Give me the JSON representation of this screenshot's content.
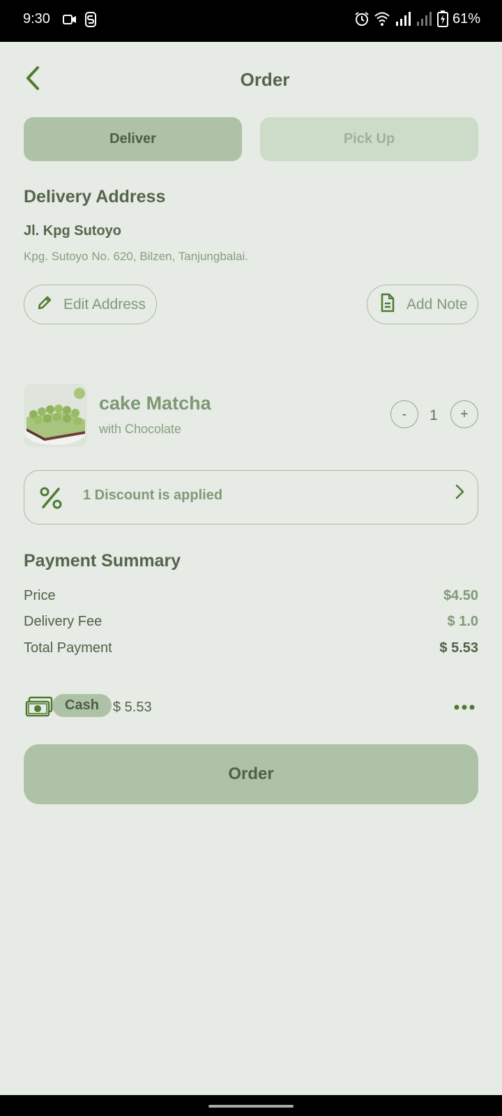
{
  "status_bar": {
    "time": "9:30",
    "battery": "61%"
  },
  "header": {
    "title": "Order"
  },
  "delivery_tabs": {
    "deliver": "Deliver",
    "pickup": "Pick Up"
  },
  "address": {
    "section_title": "Delivery Address",
    "name": "Jl. Kpg Sutoyo",
    "detail": "Kpg. Sutoyo No. 620, Bilzen, Tanjungbalai.",
    "edit_label": "Edit Address",
    "note_label": "Add Note"
  },
  "item": {
    "name": "cake Matcha",
    "subtitle": "with Chocolate",
    "minus": "-",
    "quantity": "1",
    "plus": "+"
  },
  "discount": {
    "label": "1 Discount is applied"
  },
  "payment_summary": {
    "title": "Payment Summary",
    "rows": [
      {
        "label": "Price",
        "value": "$4.50"
      },
      {
        "label": "Delivery Fee",
        "value": "$ 1.0"
      },
      {
        "label": "Total Payment",
        "value": "$ 5.53"
      }
    ]
  },
  "payment_method": {
    "method": "Cash",
    "amount": "$ 5.53"
  },
  "actions": {
    "order_label": "Order"
  },
  "colors": {
    "background": "#e6ebe5",
    "accent": "#adc2a7",
    "primary_text": "#4f6146",
    "icon": "#4e7a33"
  },
  "icons": [
    "back-arrow-icon",
    "pencil-icon",
    "document-icon",
    "percent-icon",
    "chevron-right-icon",
    "cash-icon",
    "more-icon"
  ]
}
